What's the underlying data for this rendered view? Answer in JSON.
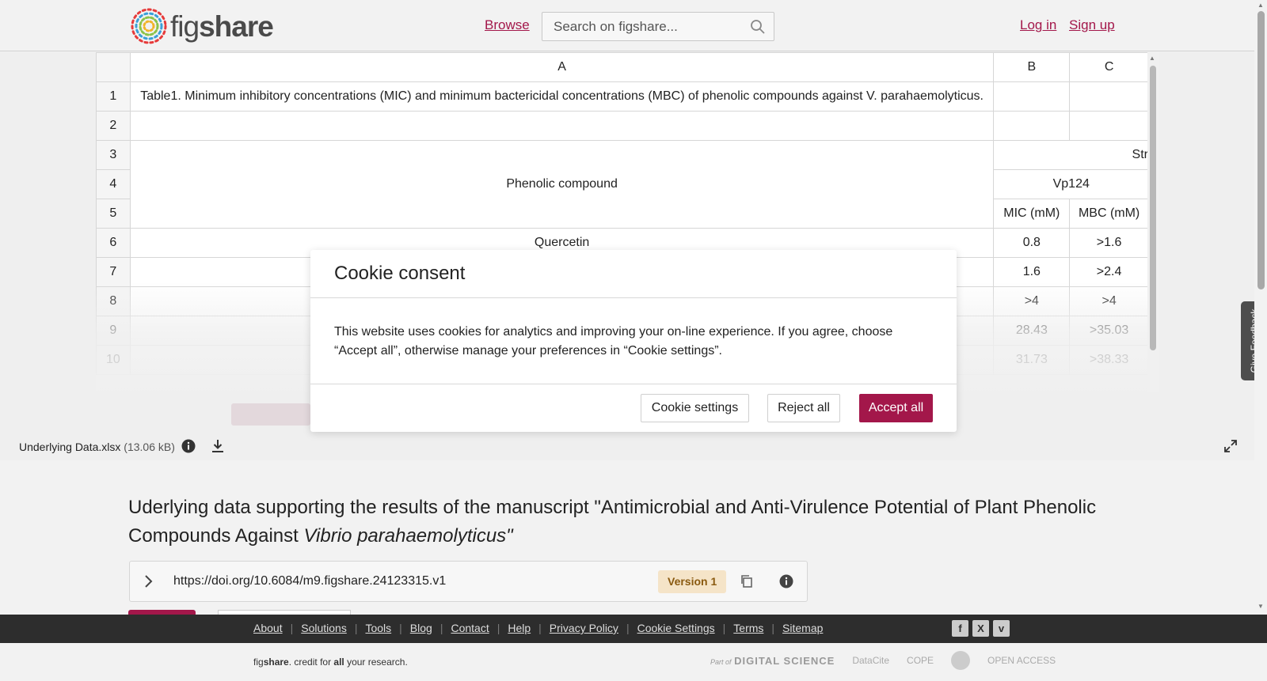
{
  "header": {
    "logo_text_light": "fig",
    "logo_text_bold": "share",
    "browse": "Browse",
    "search_placeholder": "Search on figshare...",
    "login": "Log in",
    "signup": "Sign up"
  },
  "sheet": {
    "columns": [
      "A",
      "B",
      "C"
    ],
    "rows": [
      {
        "n": "1",
        "a": "Table1. Minimum inhibitory concentrations (MIC) and minimum bactericidal concentrations (MBC) of phenolic compounds against V. parahaemolyticus.",
        "b": "",
        "c": ""
      },
      {
        "n": "2",
        "a": "",
        "b": "",
        "c": ""
      },
      {
        "n": "3",
        "a": "",
        "bc": "Str"
      },
      {
        "n": "4",
        "a": "Phenolic compound",
        "bc": "Vp124"
      },
      {
        "n": "5",
        "a": "",
        "b": "MIC (mM)",
        "c": "MBC (mM)"
      },
      {
        "n": "6",
        "a": "Quercetin",
        "b": "0.8",
        "c": ">1.6"
      },
      {
        "n": "7",
        "a": "",
        "b": "1.6",
        "c": ">2.4"
      },
      {
        "n": "8",
        "a": "",
        "b": ">4",
        "c": ">4"
      },
      {
        "n": "9",
        "a": "",
        "b": "28.43",
        "c": ">35.03"
      },
      {
        "n": "10",
        "a": "",
        "b": "31.73",
        "c": ">38.33"
      }
    ]
  },
  "file": {
    "name": "Underlying Data.xlsx",
    "size": "(13.06 kB)"
  },
  "feedback": "Give Feedback",
  "article": {
    "title_main": "Uderlying data supporting the results of the manuscript \"Antimicrobial and Anti-Virulence Potential of Plant Phenolic Compounds Against ",
    "title_italic": "Vibrio parahaemolyticus\"",
    "doi": "https://doi.org/10.6084/m9.figshare.24123315.v1",
    "version": "Version 1"
  },
  "footer": {
    "links": [
      "About",
      "Solutions",
      "Tools",
      "Blog",
      "Contact",
      "Help",
      "Privacy Policy",
      "Cookie Settings",
      "Terms",
      "Sitemap"
    ],
    "tagline_fig": "fig",
    "tagline_share": "share",
    "tagline_mid": ". credit for ",
    "tagline_all": "all",
    "tagline_end": " your research.",
    "partner_ds_prefix": "Part of",
    "partner_ds": "DIGITAL SCIENCE",
    "partner_datacite": "DataCite",
    "partner_cope": "COPE",
    "partner_oa": "OPEN ACCESS"
  },
  "cookie": {
    "title": "Cookie consent",
    "body": "This website uses cookies for analytics and improving your on-line experience. If you agree, choose “Accept all”, otherwise manage your preferences in “Cookie settings”.",
    "settings": "Cookie settings",
    "reject": "Reject all",
    "accept": "Accept all"
  },
  "colors": {
    "brand": "#a3174a",
    "footer_bg": "#2d2d2d"
  }
}
